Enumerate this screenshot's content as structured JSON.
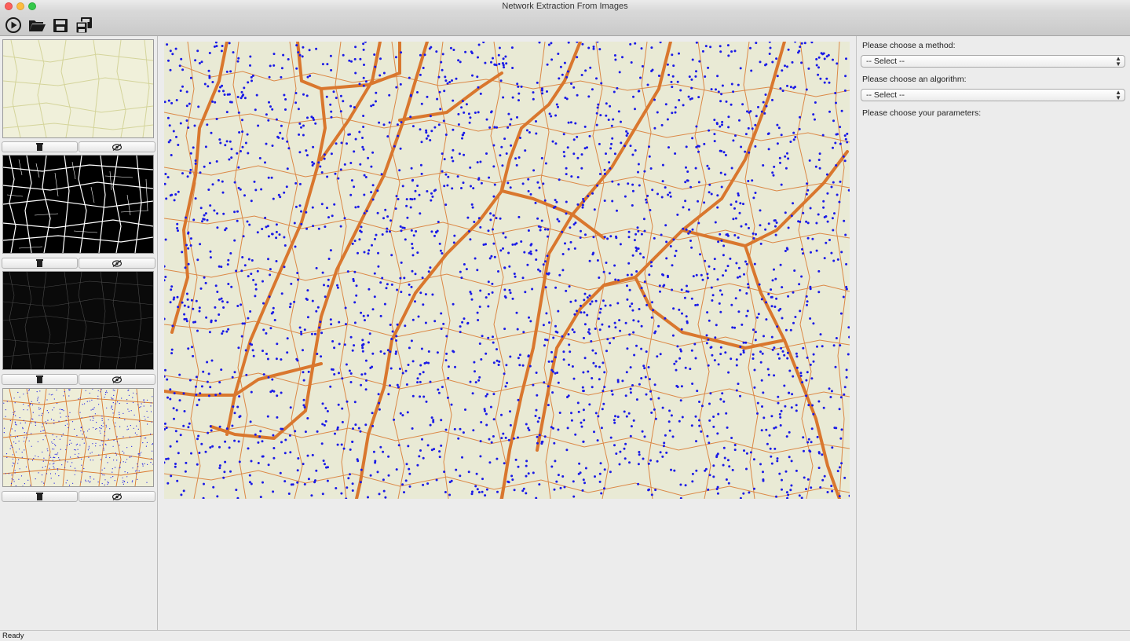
{
  "window": {
    "title": "Network Extraction From Images",
    "traffic_colors": [
      "#fc605c",
      "#fdbc40",
      "#34c84a"
    ]
  },
  "toolbar": {
    "buttons": [
      {
        "icon": "play-icon"
      },
      {
        "icon": "open-folder-icon"
      },
      {
        "icon": "save-icon"
      },
      {
        "icon": "save-all-icon"
      }
    ]
  },
  "sidebar": {
    "layers": [
      {
        "kind": "original-leaf-image",
        "delete_icon": "trash-icon",
        "hide_icon": "eye-slash-icon"
      },
      {
        "kind": "binary-segmentation",
        "delete_icon": "trash-icon",
        "hide_icon": "eye-slash-icon"
      },
      {
        "kind": "skeleton",
        "delete_icon": "trash-icon",
        "hide_icon": "eye-slash-icon"
      },
      {
        "kind": "network-overlay",
        "delete_icon": "trash-icon",
        "hide_icon": "eye-slash-icon"
      }
    ]
  },
  "colors": {
    "leaf_bg": "#e9ead5",
    "vein_edge": "#d9772e",
    "node": "#1a1ae6"
  },
  "panel": {
    "method_label": "Please choose a method:",
    "method_value": "-- Select --",
    "algorithm_label": "Please choose an algorithm:",
    "algorithm_value": "-- Select --",
    "parameters_label": "Please choose your parameters:"
  },
  "status": {
    "text": "Ready"
  }
}
